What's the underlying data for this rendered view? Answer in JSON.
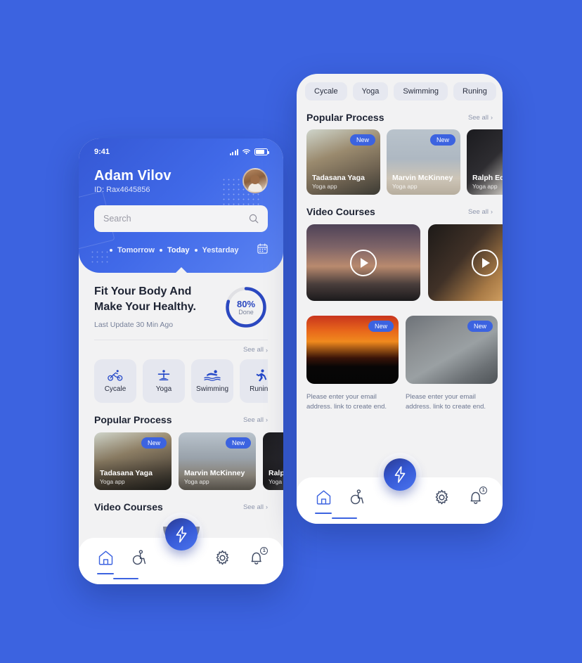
{
  "theme": {
    "background": "#3c63e0",
    "accent": "#3c63e0",
    "header_gradient_from": "#3558d4",
    "header_gradient_to": "#5b83f2",
    "screen_bg": "#f2f2f3",
    "chip_bg": "#e5e7ef",
    "text_dark": "#1d2333",
    "text_muted": "#77819a"
  },
  "phone_one": {
    "status_bar": {
      "time": "9:41",
      "signal_icon": "signal-bars-icon",
      "wifi_icon": "wifi-icon",
      "battery_icon": "battery-icon"
    },
    "user": {
      "name": "Adam Vilov",
      "id": "ID: Rax4645856",
      "avatar_icon": "user-avatar"
    },
    "search": {
      "placeholder": "Search",
      "value": "",
      "icon": "search-icon"
    },
    "days": {
      "items": [
        {
          "label": "Tomorrow",
          "active": false
        },
        {
          "label": "Today",
          "active": true
        },
        {
          "label": "Yestarday",
          "active": false
        }
      ],
      "calendar_icon": "calendar-icon"
    },
    "hero": {
      "title": "Fit Your Body And Make Your Healthy.",
      "subtitle": "Last Update 30 Min Ago",
      "progress_percent": "80%",
      "progress_value": 80,
      "progress_label": "Done"
    },
    "see_all": "See all",
    "see_all_chevron": "chevron-right-icon",
    "categories": [
      {
        "label": "Cycale",
        "icon": "cycling-icon"
      },
      {
        "label": "Yoga",
        "icon": "yoga-icon"
      },
      {
        "label": "Swimming",
        "icon": "swimming-icon"
      },
      {
        "label": "Runing",
        "icon": "running-icon"
      }
    ],
    "popular_process": {
      "title": "Popular Process",
      "see_all": "See all",
      "cards": [
        {
          "name": "Tadasana Yaga",
          "subtitle": "Yoga app",
          "badge": "New",
          "image": "woman-yoga-backbend-photo"
        },
        {
          "name": "Marvin McKinney",
          "subtitle": "Yoga app",
          "badge": "New",
          "image": "beach-group-yoga-photo"
        },
        {
          "name": "Ralph Edwards",
          "subtitle": "Yoga app",
          "badge": "",
          "image": "dark-studio-photo"
        }
      ]
    },
    "video_courses": {
      "title": "Video Courses",
      "see_all": "See all"
    },
    "bottom_nav": {
      "items": [
        {
          "icon": "home-icon",
          "active": true
        },
        {
          "icon": "accessibility-icon",
          "active": false
        },
        {
          "icon": "settings-gear-icon",
          "active": false
        },
        {
          "icon": "notification-bell-icon",
          "active": false,
          "badge": "1"
        }
      ],
      "fab_icon": "lightning-bolt-icon"
    }
  },
  "phone_two": {
    "tabs": [
      {
        "label": "Cycale"
      },
      {
        "label": "Yoga"
      },
      {
        "label": "Swimming"
      },
      {
        "label": "Runing"
      }
    ],
    "popular_process": {
      "title": "Popular Process",
      "see_all": "See all",
      "cards": [
        {
          "name": "Tadasana Yaga",
          "subtitle": "Yoga app",
          "badge": "New",
          "image": "woman-yoga-backbend-photo"
        },
        {
          "name": "Marvin McKinney",
          "subtitle": "Yoga app",
          "badge": "New",
          "image": "beach-group-yoga-photo"
        },
        {
          "name": "Ralph Edwards",
          "subtitle": "Yoga app",
          "badge": "",
          "image": "dark-studio-photo"
        }
      ]
    },
    "video_courses": {
      "title": "Video Courses",
      "see_all": "See all",
      "videos": [
        {
          "image": "sunset-yoga-pose-photo",
          "play_icon": "play-icon"
        },
        {
          "image": "wooden-studio-photo",
          "play_icon": "play-icon"
        }
      ]
    },
    "promos": [
      {
        "badge": "New",
        "image": "sunset-silhouette-party-photo",
        "text": "Please enter your email address. link to create end."
      },
      {
        "badge": "New",
        "image": "woman-meditating-photo",
        "text": "Please enter your email address. link to create end."
      }
    ],
    "bottom_nav": {
      "items": [
        {
          "icon": "home-icon",
          "active": true
        },
        {
          "icon": "accessibility-icon",
          "active": false
        },
        {
          "icon": "settings-gear-icon",
          "active": false
        },
        {
          "icon": "notification-bell-icon",
          "active": false,
          "badge": "1"
        }
      ],
      "fab_icon": "lightning-bolt-icon"
    }
  }
}
